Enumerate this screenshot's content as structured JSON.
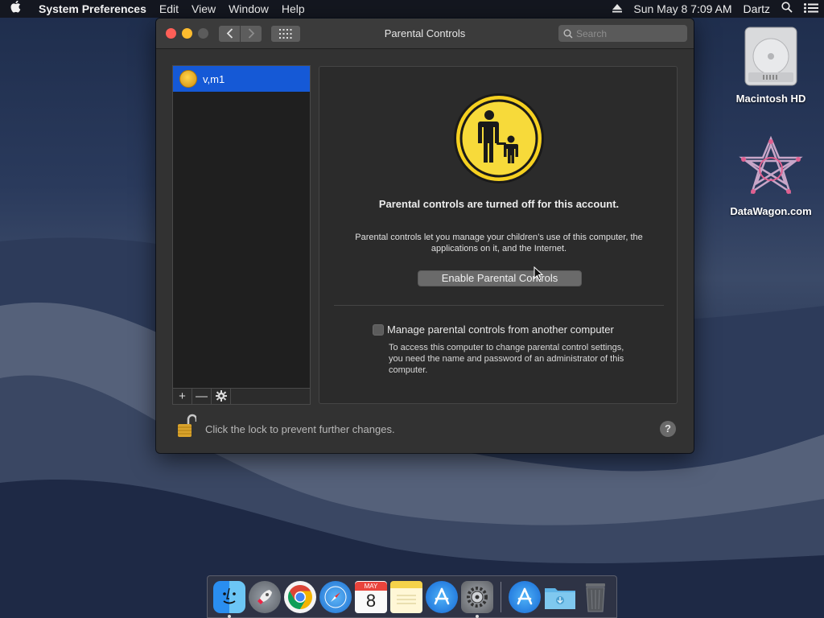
{
  "menubar": {
    "app_name": "System Preferences",
    "menus": [
      "Edit",
      "View",
      "Window",
      "Help"
    ],
    "clock": "Sun May 8  7:09 AM",
    "user": "Dartz"
  },
  "desktop": {
    "icons": [
      {
        "label": "Macintosh HD",
        "icon": "hard-drive-icon"
      },
      {
        "label": "DataWagon.com",
        "icon": "datawagon-icon"
      }
    ]
  },
  "window": {
    "title": "Parental Controls",
    "search_placeholder": "Search"
  },
  "user_list": {
    "users": [
      {
        "name": "v,m1",
        "selected": true
      }
    ],
    "toolbar": {
      "add": "+",
      "remove": "—",
      "action": "⚙"
    }
  },
  "panel": {
    "status_title": "Parental controls are turned off for this account.",
    "status_description": "Parental controls let you manage your children’s use of this computer, the applications on it, and the Internet.",
    "enable_button": "Enable Parental Controls",
    "remote_label": "Manage parental controls from another computer",
    "remote_checked": false,
    "remote_description": "To access this computer to change parental control settings, you need the name and password of an administrator of this computer."
  },
  "lock": {
    "text": "Click the lock to prevent further changes.",
    "state": "unlocked"
  },
  "help_button": "?",
  "colors": {
    "selection": "#1559d6",
    "window_bg": "#323232",
    "icon_yellow": "#f5d020"
  },
  "dock": {
    "items": [
      {
        "name": "finder",
        "icon": "finder-icon",
        "running": true
      },
      {
        "name": "launchpad",
        "icon": "rocket-icon",
        "running": false
      },
      {
        "name": "chrome",
        "icon": "chrome-icon",
        "running": false
      },
      {
        "name": "safari",
        "icon": "compass-icon",
        "running": false
      },
      {
        "name": "calendar",
        "icon": "calendar-icon",
        "running": false,
        "month": "MAY",
        "day": "8"
      },
      {
        "name": "notes",
        "icon": "notes-icon",
        "running": false
      },
      {
        "name": "app-store",
        "icon": "app-store-icon",
        "running": false
      },
      {
        "name": "system-preferences",
        "icon": "gear-icon",
        "running": true
      },
      {
        "name": "app-store-2",
        "icon": "app-store-icon",
        "running": false
      },
      {
        "name": "downloads",
        "icon": "folder-icon",
        "running": false
      },
      {
        "name": "trash",
        "icon": "trash-icon",
        "running": false
      }
    ]
  }
}
